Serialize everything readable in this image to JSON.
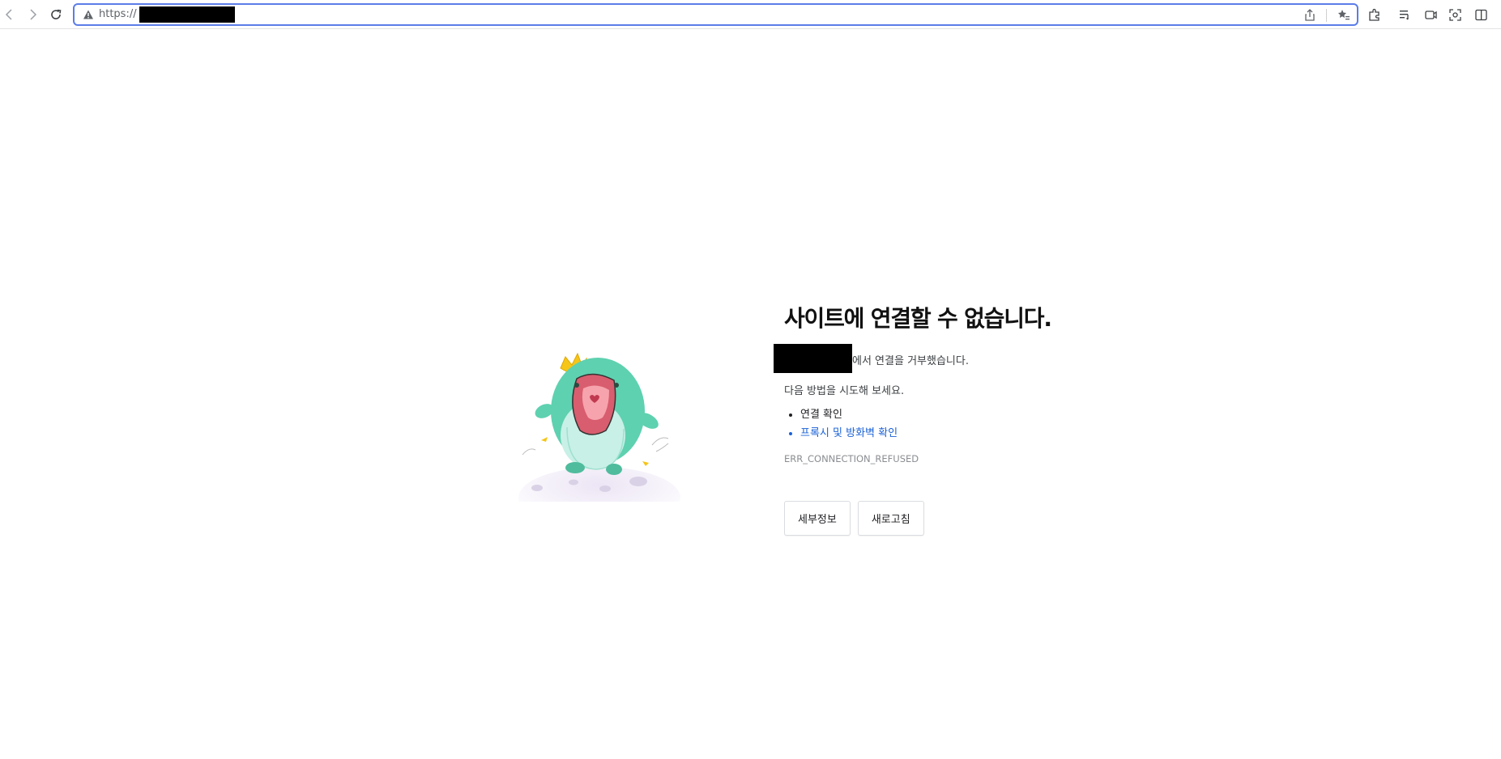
{
  "browser": {
    "url_prefix": "https://",
    "icons": {
      "back": "back-arrow-icon",
      "forward": "forward-arrow-icon",
      "reload": "reload-icon",
      "security": "warning-icon",
      "share": "share-icon",
      "favorites": "favorites-icon",
      "extensions": "extensions-icon",
      "reading_list": "reading-list-icon",
      "capture": "capture-icon",
      "screenshot": "screenshot-icon",
      "split": "split-view-icon"
    },
    "accent_color": "#5b7de8"
  },
  "error_page": {
    "title": "사이트에 연결할 수 없습니다.",
    "host_message": "에서 연결을 거부했습니다.",
    "try_text": "다음 방법을 시도해 보세요.",
    "suggestions": [
      {
        "label": "연결 확인",
        "is_link": false
      },
      {
        "label": "프록시 및 방화벽 확인",
        "is_link": true
      }
    ],
    "error_code": "ERR_CONNECTION_REFUSED",
    "details_button": "세부정보",
    "reload_button": "새로고침",
    "link_color": "#1a62d6"
  }
}
